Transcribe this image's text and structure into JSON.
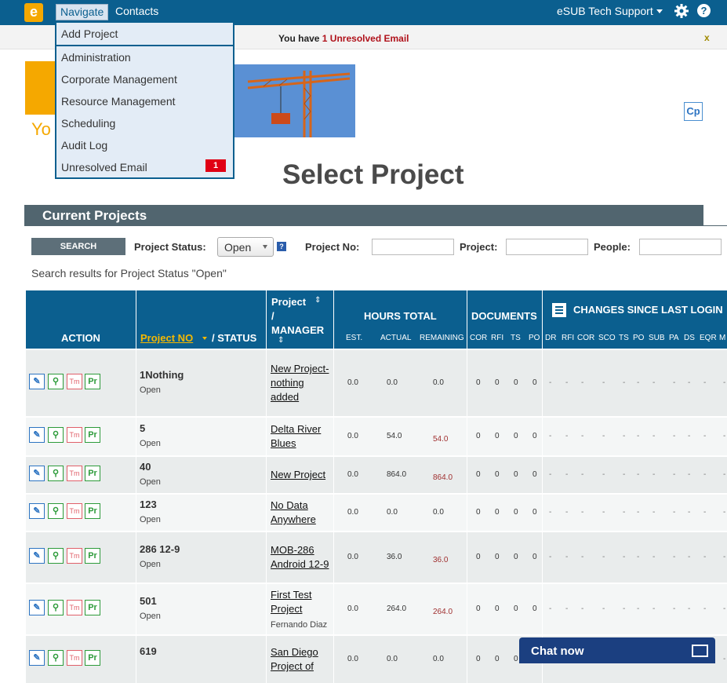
{
  "topbar": {
    "logo_letter": "e",
    "nav_navigate": "Navigate",
    "nav_contacts": "Contacts",
    "user": "eSUB Tech Support",
    "help": "?"
  },
  "notice": {
    "prefix": "You have ",
    "link": "1 Unresolved Email",
    "close": "x"
  },
  "menu": {
    "items": [
      "Add Project",
      "Administration",
      "Corporate Management",
      "Resource Management",
      "Scheduling",
      "Audit Log",
      "Unresolved Email"
    ],
    "badge": "1"
  },
  "banner": {
    "partial_text": "Yo",
    "cp": "Cp"
  },
  "title": "Select Project",
  "section": "Current Projects",
  "search": {
    "button": "SEARCH",
    "status_label": "Project Status:",
    "status_value": "Open",
    "help": "?",
    "project_no_label": "Project No:",
    "project_label": "Project:",
    "people_label": "People:",
    "results": "Search results for Project Status \"Open\""
  },
  "headers": {
    "action": "ACTION",
    "project_no": "Project NO",
    "status": "/ STATUS",
    "project_manager_1": "Project",
    "project_manager_2": "/",
    "project_manager_3": "MANAGER",
    "hours_total": "HOURS TOTAL",
    "est": "EST.",
    "actual": "ACTUAL",
    "remaining": "REMAINING",
    "documents": "DOCUMENTS",
    "doc_cols": [
      "COR",
      "RFI",
      "TS",
      "PO"
    ],
    "changes": "CHANGES SINCE LAST LOGIN",
    "change_cols": [
      "DR",
      "RFI",
      "COR",
      "SCO",
      "TS",
      "PO",
      "SUB",
      "PA",
      "DS",
      "EQR",
      "M"
    ]
  },
  "icons": {
    "tm": "Tm",
    "pr": "Pr"
  },
  "rows": [
    {
      "no": "1Nothing",
      "status": "Open",
      "name": "New Project-nothing added",
      "manager": "",
      "est": "0.0",
      "actual": "0.0",
      "remaining": "0.0",
      "remaining_red": false,
      "docs": [
        "0",
        "0",
        "0",
        "0"
      ]
    },
    {
      "no": "5",
      "status": "Open",
      "name": "Delta River Blues",
      "manager": "",
      "est": "0.0",
      "actual": "54.0",
      "remaining": "54.0",
      "remaining_red": true,
      "docs": [
        "0",
        "0",
        "0",
        "0"
      ]
    },
    {
      "no": "40",
      "status": "Open",
      "name": "New Project",
      "manager": "",
      "est": "0.0",
      "actual": "864.0",
      "remaining": "864.0",
      "remaining_red": true,
      "docs": [
        "0",
        "0",
        "0",
        "0"
      ]
    },
    {
      "no": "123",
      "status": "Open",
      "name": "No Data Anywhere",
      "manager": "",
      "est": "0.0",
      "actual": "0.0",
      "remaining": "0.0",
      "remaining_red": false,
      "docs": [
        "0",
        "0",
        "0",
        "0"
      ]
    },
    {
      "no": "286 12-9",
      "status": "Open",
      "name": "MOB-286 Android 12-9",
      "manager": "",
      "est": "0.0",
      "actual": "36.0",
      "remaining": "36.0",
      "remaining_red": true,
      "docs": [
        "0",
        "0",
        "0",
        "0"
      ]
    },
    {
      "no": "501",
      "status": "Open",
      "name": "First Test Project",
      "manager": "Fernando Diaz",
      "est": "0.0",
      "actual": "264.0",
      "remaining": "264.0",
      "remaining_red": true,
      "docs": [
        "0",
        "0",
        "0",
        "0"
      ]
    },
    {
      "no": "619",
      "status": "",
      "name": "San Diego Project of",
      "manager": "",
      "est": "0.0",
      "actual": "0.0",
      "remaining": "0.0",
      "remaining_red": false,
      "docs": [
        "0",
        "0",
        "0",
        "0"
      ]
    }
  ],
  "chat": {
    "label": "Chat now"
  },
  "colors": {
    "header_blue": "#0b5f8f",
    "section_gray": "#51656f",
    "orange": "#f5a800",
    "alert_red": "#b0121b"
  }
}
